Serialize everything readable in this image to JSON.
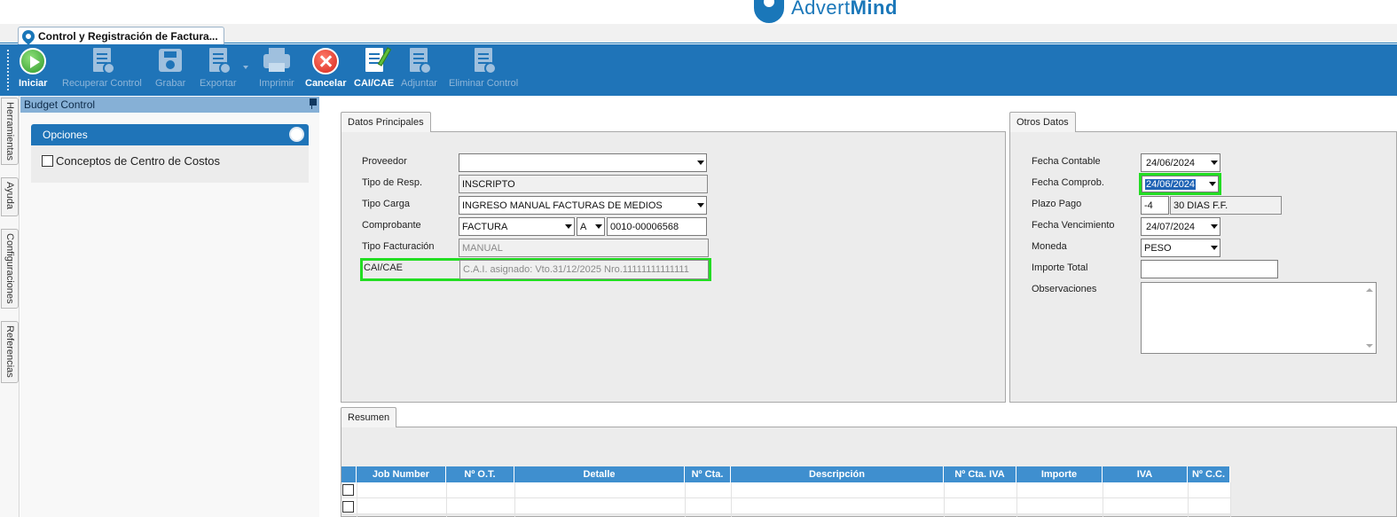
{
  "brand": {
    "logo_text_light": "Advert",
    "logo_text_bold": "Mind"
  },
  "document_tab": {
    "title": "Control y Registración de Factura..."
  },
  "toolbar": {
    "buttons": [
      {
        "label": "Iniciar",
        "enabled": true,
        "icon": "play-icon"
      },
      {
        "label": "Recuperar Control",
        "enabled": false,
        "icon": "recover-document-icon"
      },
      {
        "label": "Grabar",
        "enabled": false,
        "icon": "save-icon"
      },
      {
        "label": "Exportar",
        "enabled": false,
        "icon": "export-document-icon"
      },
      {
        "label": "Imprimir",
        "enabled": false,
        "icon": "printer-icon"
      },
      {
        "label": "Cancelar",
        "enabled": true,
        "icon": "cancel-icon"
      },
      {
        "label": "CAI/CAE",
        "enabled": true,
        "icon": "document-pen-icon"
      },
      {
        "label": "Adjuntar",
        "enabled": false,
        "icon": "attach-document-icon"
      },
      {
        "label": "Eliminar Control",
        "enabled": false,
        "icon": "delete-document-icon"
      }
    ]
  },
  "side_tabs": [
    "Herramientas",
    "Ayuda",
    "Configuraciones",
    "Referencias"
  ],
  "budget_panel": {
    "title": "Budget Control",
    "section_title": "Opciones",
    "checkbox_label": "Conceptos de Centro de Costos",
    "checkbox_checked": false
  },
  "datos_principales": {
    "tab_label": "Datos Principales",
    "proveedor": {
      "label": "Proveedor",
      "value": ""
    },
    "tipo_resp": {
      "label": "Tipo de Resp.",
      "value": "INSCRIPTO"
    },
    "tipo_carga": {
      "label": "Tipo Carga",
      "value": "INGRESO MANUAL FACTURAS DE MEDIOS"
    },
    "comprobante": {
      "label": "Comprobante",
      "tipo": "FACTURA",
      "letra": "A",
      "numero": "0010-00006568"
    },
    "tipo_facturacion": {
      "label": "Tipo Facturación",
      "value": "MANUAL"
    },
    "cai_cae": {
      "label": "CAI/CAE",
      "value": "C.A.I. asignado: Vto.31/12/2025 Nro.11111111111111"
    }
  },
  "otros_datos": {
    "tab_label": "Otros Datos",
    "fecha_contable": {
      "label": "Fecha Contable",
      "value": "24/06/2024"
    },
    "fecha_comprob": {
      "label": "Fecha Comprob.",
      "value": "24/06/2024"
    },
    "plazo_pago": {
      "label": "Plazo Pago",
      "days": "-4",
      "description": "30 DIAS F.F."
    },
    "fecha_vencimiento": {
      "label": "Fecha Vencimiento",
      "value": "24/07/2024"
    },
    "moneda": {
      "label": "Moneda",
      "value": "PESO"
    },
    "importe_total": {
      "label": "Importe Total",
      "value": ""
    },
    "observaciones": {
      "label": "Observaciones",
      "value": ""
    }
  },
  "resumen": {
    "tab_label": "Resumen",
    "columns": [
      "Job Number",
      "Nº O.T.",
      "Detalle",
      "Nº Cta.",
      "Descripción",
      "Nº Cta. IVA",
      "Importe",
      "IVA",
      "Nº C.C."
    ],
    "rows": [
      [
        "",
        "",
        "",
        "",
        "",
        "",
        "",
        "",
        ""
      ],
      [
        "",
        "",
        "",
        "",
        "",
        "",
        "",
        "",
        ""
      ]
    ]
  },
  "colors": {
    "accent": "#1f74b8",
    "panel_header": "#86b0d6",
    "grid_header": "#3f8fcf",
    "highlight": "#22dd22"
  }
}
